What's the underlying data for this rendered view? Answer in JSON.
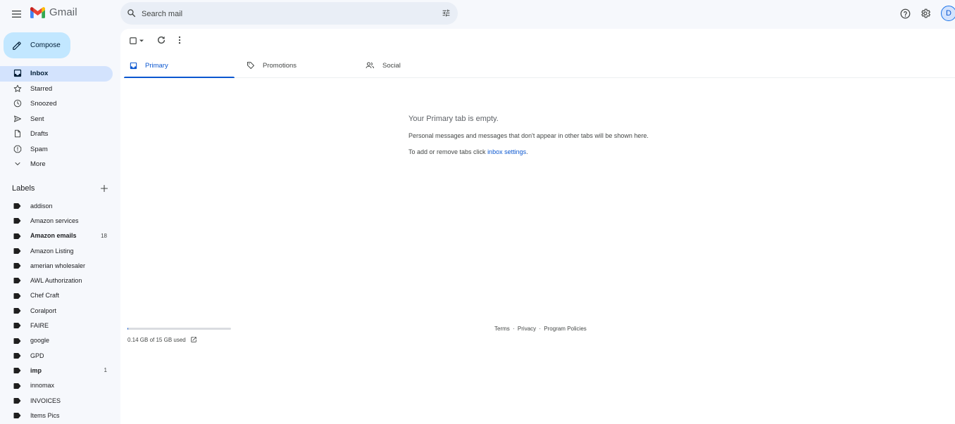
{
  "app": {
    "name": "Gmail"
  },
  "search": {
    "placeholder": "Search mail"
  },
  "header": {
    "avatar_letter": "D"
  },
  "compose": {
    "label": "Compose"
  },
  "nav": [
    {
      "label": "Inbox",
      "icon": "inbox-icon",
      "active": true
    },
    {
      "label": "Starred",
      "icon": "star-icon"
    },
    {
      "label": "Snoozed",
      "icon": "clock-icon"
    },
    {
      "label": "Sent",
      "icon": "send-icon"
    },
    {
      "label": "Drafts",
      "icon": "draft-icon"
    },
    {
      "label": "Spam",
      "icon": "spam-icon"
    },
    {
      "label": "More",
      "icon": "chevron-down-icon"
    }
  ],
  "labels": {
    "heading": "Labels",
    "items": [
      {
        "label": "addison",
        "count": "",
        "bold": false
      },
      {
        "label": "Amazon services",
        "count": "",
        "bold": false
      },
      {
        "label": "Amazon emails",
        "count": "18",
        "bold": true
      },
      {
        "label": "Amazon Listing",
        "count": "",
        "bold": false
      },
      {
        "label": "amerian wholesaler",
        "count": "",
        "bold": false
      },
      {
        "label": "AWL Authorization",
        "count": "",
        "bold": false
      },
      {
        "label": "Chef Craft",
        "count": "",
        "bold": false
      },
      {
        "label": "Coralport",
        "count": "",
        "bold": false
      },
      {
        "label": "FAIRE",
        "count": "",
        "bold": false
      },
      {
        "label": "google",
        "count": "",
        "bold": false
      },
      {
        "label": "GPD",
        "count": "",
        "bold": false
      },
      {
        "label": "imp",
        "count": "1",
        "bold": true
      },
      {
        "label": "innomax",
        "count": "",
        "bold": false
      },
      {
        "label": "INVOICES",
        "count": "",
        "bold": false
      },
      {
        "label": "Items Pics",
        "count": "",
        "bold": false
      }
    ]
  },
  "tabs": [
    {
      "label": "Primary",
      "active": true
    },
    {
      "label": "Promotions",
      "active": false
    },
    {
      "label": "Social",
      "active": false
    }
  ],
  "empty": {
    "title": "Your Primary tab is empty.",
    "line1": "Personal messages and messages that don't appear in other tabs will be shown here.",
    "line2_prefix": "To add or remove tabs click ",
    "line2_link": "inbox settings",
    "line2_suffix": "."
  },
  "storage": {
    "text": "0.14 GB of 15 GB used",
    "used_fraction": 0.01
  },
  "footer": {
    "terms": "Terms",
    "privacy": "Privacy",
    "policies": "Program Policies",
    "separator": "·"
  },
  "colors": {
    "accent": "#0b57d0",
    "compose_bg": "#c2e7ff",
    "active_nav": "#d3e3fd",
    "background": "#f6f8fc"
  }
}
